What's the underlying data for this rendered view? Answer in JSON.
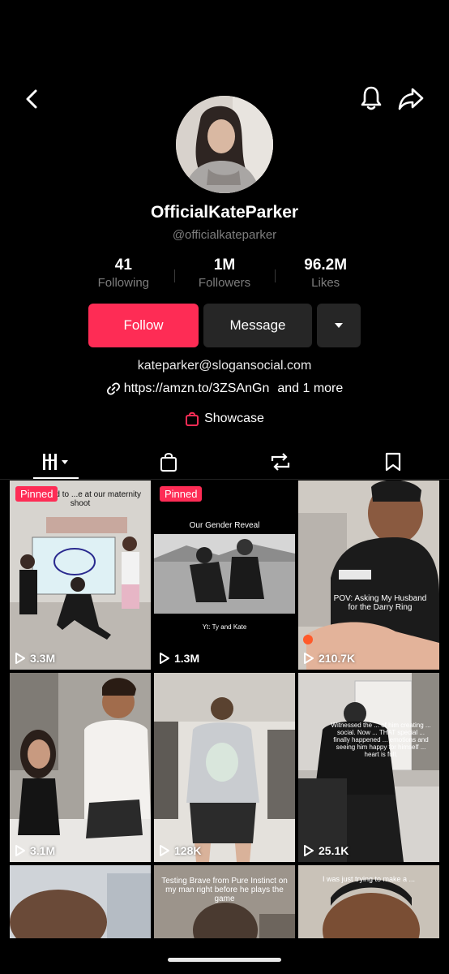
{
  "profile": {
    "display_name": "OfficialKateParker",
    "handle": "@officialkateparker"
  },
  "stats": [
    {
      "value": "41",
      "label": "Following"
    },
    {
      "value": "1M",
      "label": "Followers"
    },
    {
      "value": "96.2M",
      "label": "Likes"
    }
  ],
  "actions": {
    "follow": "Follow",
    "message": "Message"
  },
  "bio": {
    "email": "kateparker@slogansocial.com",
    "link": "https://amzn.to/3ZSAnGn",
    "link_more": "and 1 more",
    "showcase": "Showcase"
  },
  "videos": [
    {
      "views": "3.3M",
      "pinned": "Pinned",
      "caption": "...proposed to ...e at our maternity shoot"
    },
    {
      "views": "1.3M",
      "pinned": "Pinned",
      "caption": "Our Gender Reveal",
      "caption2": "Yt: Ty and Kate"
    },
    {
      "views": "210.7K",
      "caption": "POV: Asking My Husband for the Darry Ring"
    },
    {
      "views": "3.1M"
    },
    {
      "views": "128K"
    },
    {
      "views": "25.1K",
      "caption": "Witnessed the ... of him creating ... social. Now ... THAT special ... finally happened ... emotions and seeing him happy for himself ... heart is full."
    },
    {
      "caption": "Testing Brave from Pure Instinct on my man right before he plays the game"
    },
    {
      "caption": "I was just trying to make a ..."
    }
  ],
  "colors": {
    "accent": "#fe2c55",
    "button_dark": "#262626",
    "muted_text": "#7d7d7d"
  }
}
